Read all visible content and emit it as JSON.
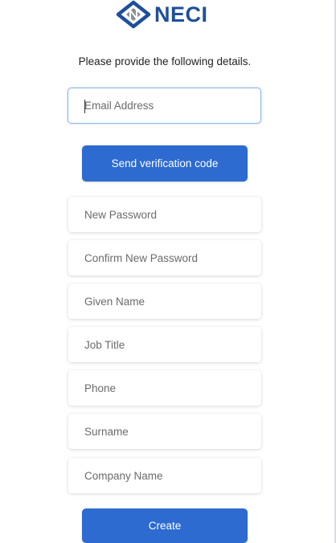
{
  "header": {
    "brand_name": "NECI"
  },
  "form": {
    "instructions": "Please provide the following details.",
    "email": {
      "placeholder": "Email Address",
      "value": ""
    },
    "send_code_label": "Send verification code",
    "fields": [
      {
        "placeholder": "New Password"
      },
      {
        "placeholder": "Confirm New Password"
      },
      {
        "placeholder": "Given Name"
      },
      {
        "placeholder": "Job Title"
      },
      {
        "placeholder": "Phone"
      },
      {
        "placeholder": "Surname"
      },
      {
        "placeholder": "Company Name"
      }
    ],
    "create_label": "Create"
  },
  "colors": {
    "brand_blue": "#1e4f9c",
    "button_blue": "#2d6bd0",
    "focus_border": "#8fb3e6"
  },
  "icons": {
    "logo": "neci-logo-icon"
  }
}
